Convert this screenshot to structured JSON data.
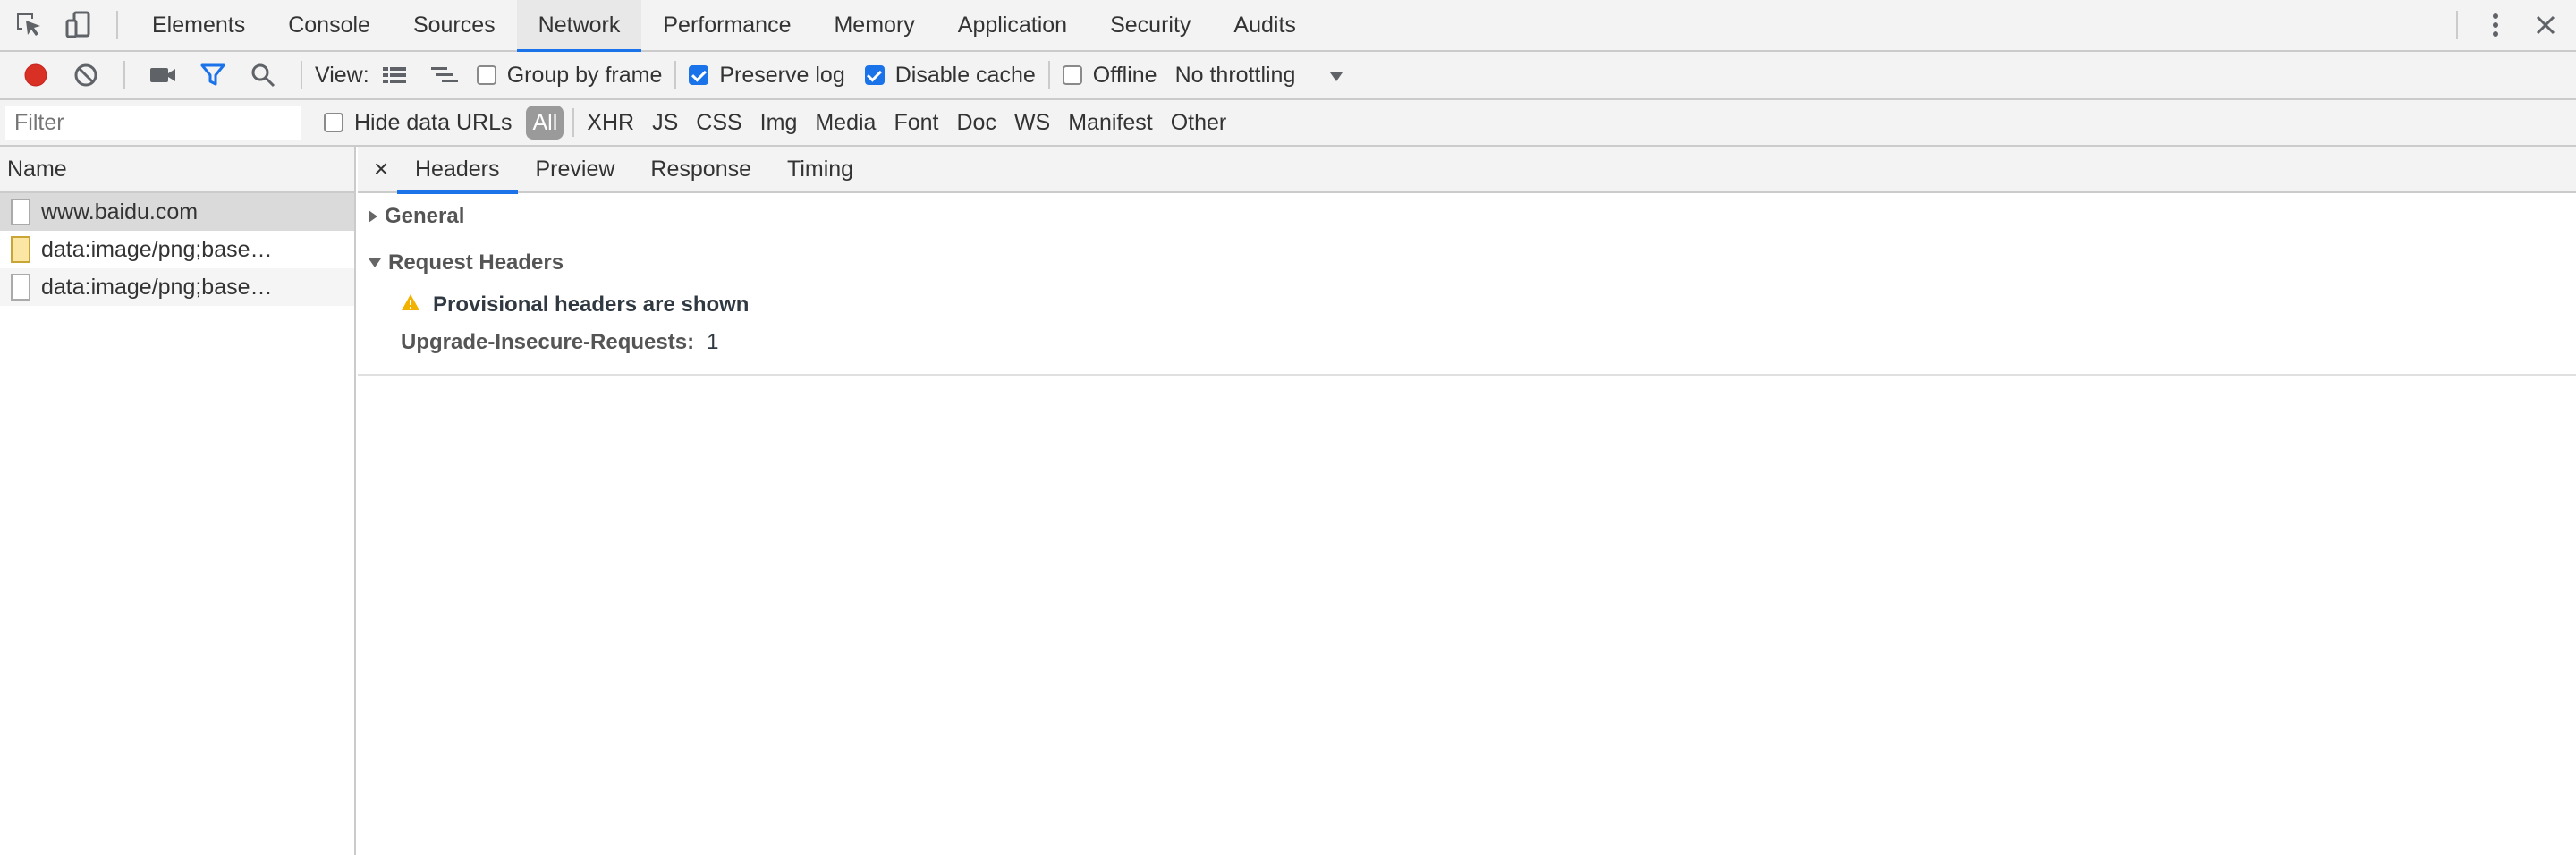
{
  "tabs": [
    "Elements",
    "Console",
    "Sources",
    "Network",
    "Performance",
    "Memory",
    "Application",
    "Security",
    "Audits"
  ],
  "toolbar": {
    "view_label": "View:",
    "group_by_frame": "Group by frame",
    "preserve_log": "Preserve log",
    "disable_cache": "Disable cache",
    "offline": "Offline",
    "throttling": "No throttling"
  },
  "filter": {
    "placeholder": "Filter",
    "hide_data_urls": "Hide data URLs",
    "types": [
      "All",
      "XHR",
      "JS",
      "CSS",
      "Img",
      "Media",
      "Font",
      "Doc",
      "WS",
      "Manifest",
      "Other"
    ]
  },
  "requests": {
    "column_name": "Name",
    "items": [
      "www.baidu.com",
      "data:image/png;base…",
      "data:image/png;base…"
    ]
  },
  "details": {
    "tabs": [
      "Headers",
      "Preview",
      "Response",
      "Timing"
    ],
    "general": "General",
    "request_headers": "Request Headers",
    "provisional": "Provisional headers are shown",
    "header_name": "Upgrade-Insecure-Requests:",
    "header_value": "1"
  },
  "colors": {
    "accent": "#1a73e8",
    "record": "#d93025",
    "warning": "#f2b200"
  },
  "icons": [
    "inspect-icon",
    "device-icon",
    "more-icon",
    "close-icon",
    "record-icon",
    "clear-icon",
    "camera-icon",
    "filter-icon",
    "search-icon",
    "list-view-icon",
    "waterfall-view-icon",
    "dropdown-arrow-icon",
    "warning-icon"
  ]
}
